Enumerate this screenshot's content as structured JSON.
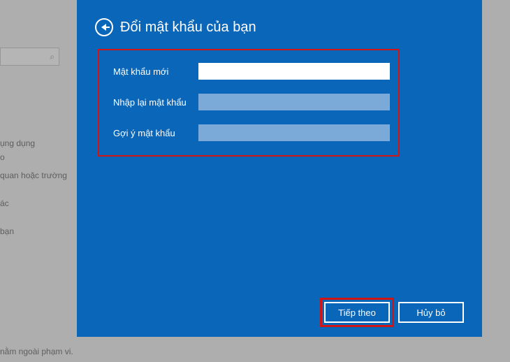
{
  "background": {
    "search_icon": "⌕",
    "items": [
      "ụng dụng",
      "o",
      "quan hoặc trường",
      "ác",
      "bạn",
      "nằm ngoài phạm vi."
    ]
  },
  "panel": {
    "title": "Đổi mật khẩu của bạn"
  },
  "form": {
    "row1_label": "Mật khẩu mới",
    "row2_label": "Nhập lại mật khẩu",
    "row3_label": "Gợi ý mật khẩu"
  },
  "buttons": {
    "next": "Tiếp theo",
    "cancel": "Hủy bỏ"
  }
}
